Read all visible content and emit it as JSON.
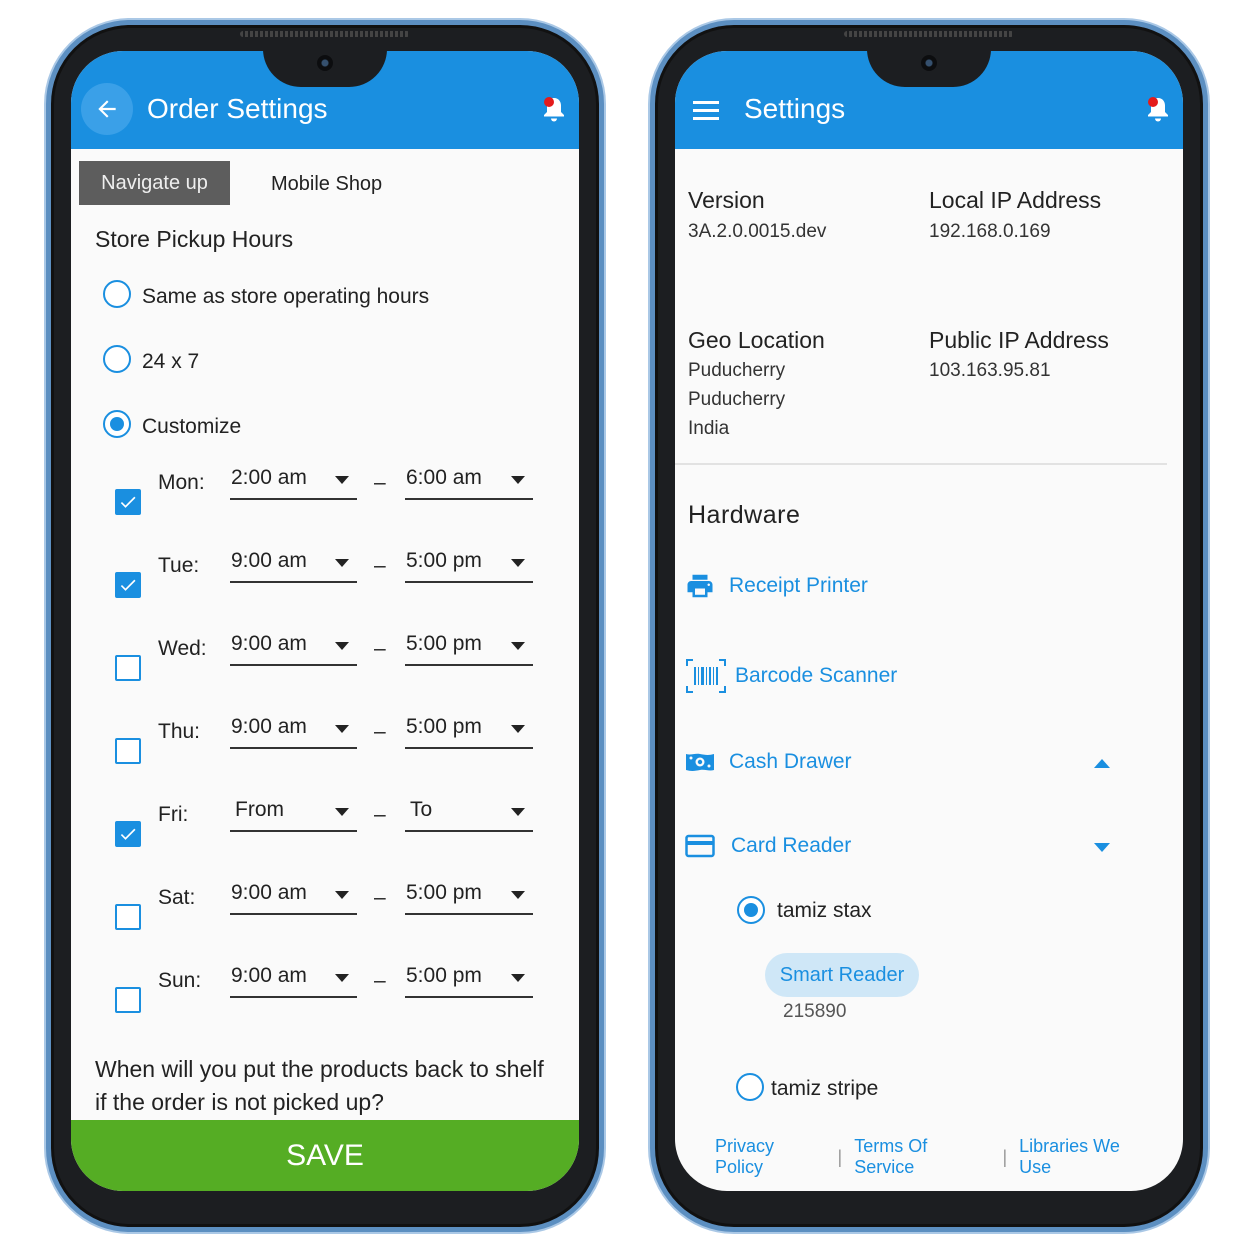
{
  "colors": {
    "primary": "#1a8fe0",
    "save": "#55ad24",
    "bezel": "#5c8fc1"
  },
  "order_settings": {
    "title": "Order Settings",
    "tooltip": "Navigate up",
    "store_name": "Mobile Shop",
    "section_title": "Store Pickup Hours",
    "options": [
      {
        "label": "Same as store operating hours",
        "selected": false
      },
      {
        "label": "24 x 7",
        "selected": false
      },
      {
        "label": "Customize",
        "selected": true
      }
    ],
    "dash": "–",
    "days": [
      {
        "day": "Mon:",
        "checked": true,
        "from": "2:00 am",
        "to": "6:00 am"
      },
      {
        "day": "Tue:",
        "checked": true,
        "from": "9:00 am",
        "to": "5:00 pm"
      },
      {
        "day": "Wed:",
        "checked": false,
        "from": "9:00 am",
        "to": "5:00 pm"
      },
      {
        "day": "Thu:",
        "checked": false,
        "from": "9:00 am",
        "to": "5:00 pm"
      },
      {
        "day": "Fri:",
        "checked": true,
        "from": "From",
        "to": "To"
      },
      {
        "day": "Sat:",
        "checked": false,
        "from": "9:00 am",
        "to": "5:00 pm"
      },
      {
        "day": "Sun:",
        "checked": false,
        "from": "9:00 am",
        "to": "5:00 pm"
      }
    ],
    "question": "When will you put the products back to shelf if the order is not picked up?",
    "save_label": "SAVE"
  },
  "settings": {
    "title": "Settings",
    "version_label": "Version",
    "version_value": "3A.2.0.0015.dev",
    "local_ip_label": "Local IP Address",
    "local_ip_value": "192.168.0.169",
    "geo_label": "Geo Location",
    "geo_lines": [
      "Puducherry",
      "Puducherry",
      "India"
    ],
    "public_ip_label": "Public IP Address",
    "public_ip_value": "103.163.95.81",
    "hardware_title": "Hardware",
    "hardware_items": [
      {
        "label": "Receipt Printer",
        "icon": "printer-icon"
      },
      {
        "label": "Barcode Scanner",
        "icon": "barcode-icon"
      },
      {
        "label": "Cash Drawer",
        "icon": "cash-icon",
        "expand": "up"
      },
      {
        "label": "Card Reader",
        "icon": "credit-card-icon",
        "expand": "down"
      }
    ],
    "readers": [
      {
        "label": "tamiz stax",
        "selected": true
      },
      {
        "label": "tamiz stripe",
        "selected": false
      }
    ],
    "reader_chip": "Smart Reader",
    "reader_serial": "215890",
    "footer_links": [
      "Privacy Policy",
      "Terms Of Service",
      "Libraries We Use"
    ],
    "footer_separator": "|"
  }
}
